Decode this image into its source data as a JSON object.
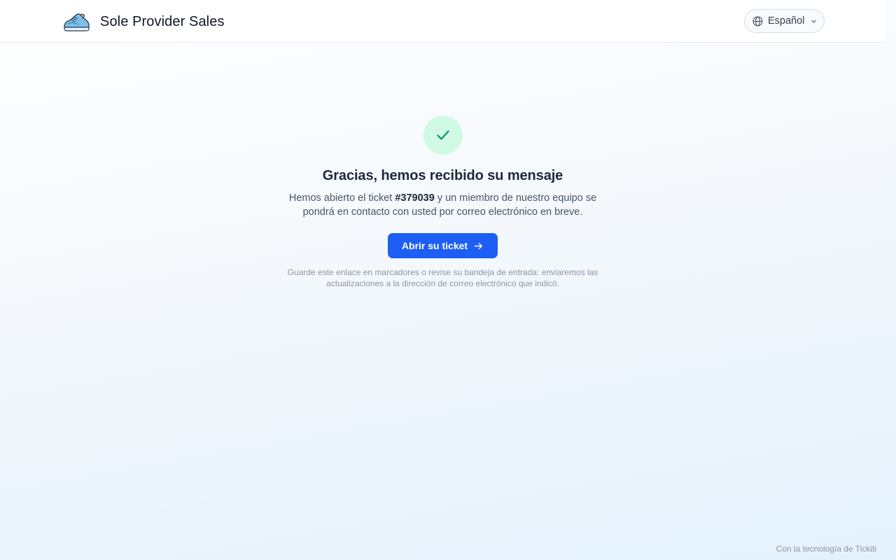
{
  "header": {
    "brand_name": "Sole Provider Sales",
    "brand_logo_icon": "sneaker-icon",
    "language": {
      "label": "Español",
      "icon": "globe-icon",
      "chevron_icon": "chevron-down-icon"
    }
  },
  "confirmation": {
    "status_icon": "check-icon",
    "title": "Gracias, hemos recibido su mensaje",
    "message_before": "Hemos abierto el ticket ",
    "ticket_number": "#379039",
    "message_after": " y un miembro de nuestro equipo se pondrá en contacto con usted por correo electrónico en breve.",
    "button_label": "Abrir su ticket",
    "button_icon": "arrow-right-icon",
    "note": "Guarde este enlace en marcadores o revise su bandeja de entrada: enviaremos las actualizaciones a la dirección de correo electrónico que indicó."
  },
  "footer": {
    "powered_by": "Con la tecnología de Tickiti"
  },
  "colors": {
    "accent": "#1d5ef5",
    "success_bg": "#d1fae5",
    "success_fg": "#059669"
  }
}
